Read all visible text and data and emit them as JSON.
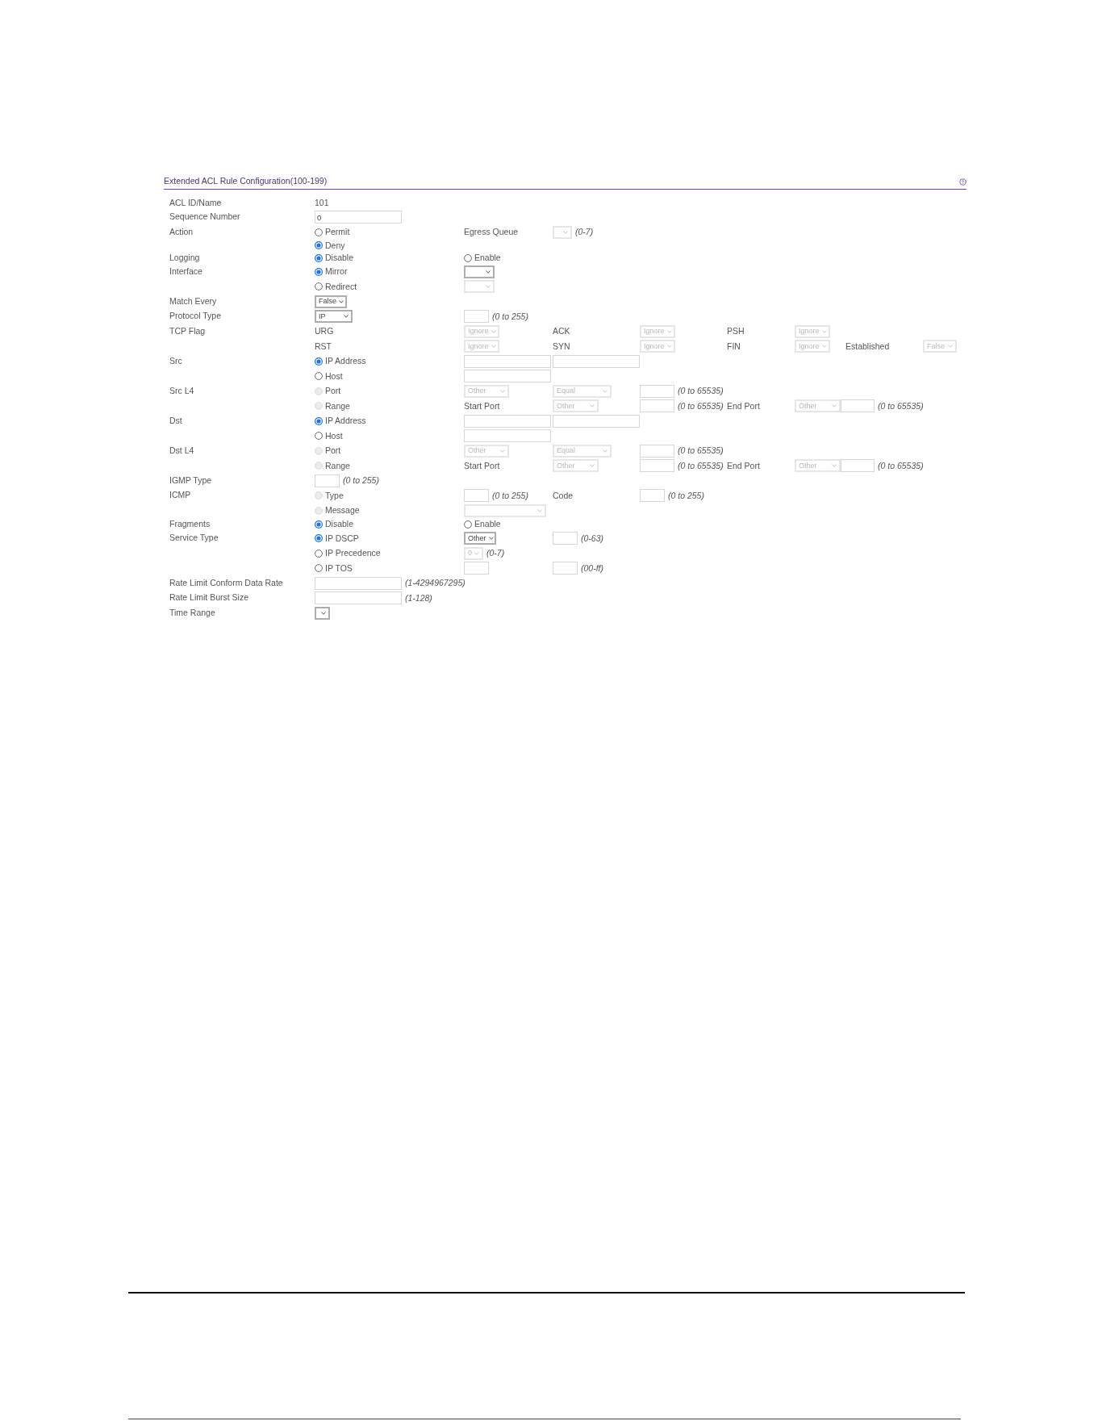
{
  "panel": {
    "title": "Extended ACL Rule Configuration(100-199)"
  },
  "lines": [
    {
      "label": "ACL ID/Name",
      "cells": [
        [
          {
            "kind": "value",
            "text": "101"
          }
        ]
      ]
    },
    {
      "label": "Sequence Number",
      "cells": [
        [
          {
            "kind": "input",
            "value": "0"
          }
        ]
      ]
    },
    {
      "label": "Action",
      "cells": [
        [
          {
            "kind": "radio",
            "label": "Permit",
            "checked": false,
            "disabled": false
          }
        ],
        [
          {
            "kind": "text",
            "text": "Egress Queue"
          }
        ],
        [
          {
            "kind": "select",
            "disabled": true
          },
          {
            "kind": "hint",
            "text": "(0-7)"
          }
        ]
      ]
    },
    {
      "cells": [
        [
          {
            "kind": "radio",
            "label": "Deny",
            "checked": true,
            "disabled": false
          }
        ]
      ]
    },
    {
      "label": "Logging",
      "cells": [
        [
          {
            "kind": "radio",
            "label": "Disable",
            "checked": true,
            "disabled": false
          }
        ],
        [
          {
            "kind": "radio",
            "label": "Enable",
            "checked": false,
            "disabled": false
          }
        ]
      ]
    },
    {
      "label": "Interface",
      "cells": [
        [
          {
            "kind": "radio",
            "label": "Mirror",
            "checked": true,
            "disabled": false
          }
        ],
        [
          {
            "kind": "select",
            "disabled": false
          }
        ]
      ]
    },
    {
      "cells": [
        [
          {
            "kind": "radio",
            "label": "Redirect",
            "checked": false,
            "disabled": false
          }
        ],
        [
          {
            "kind": "select",
            "disabled": true
          }
        ]
      ]
    },
    {
      "label": "Match Every",
      "cells": [
        [
          {
            "kind": "select",
            "value": "False",
            "disabled": false
          }
        ]
      ]
    },
    {
      "label": "Protocol Type",
      "cells": [
        [
          {
            "kind": "select",
            "value": "IP",
            "disabled": false
          }
        ],
        [
          {
            "kind": "input"
          },
          {
            "kind": "hint",
            "text": "(0 to 255)"
          }
        ]
      ]
    },
    {
      "label": "TCP Flag",
      "cells": [
        [
          {
            "kind": "text",
            "text": "URG"
          }
        ],
        [
          {
            "kind": "select",
            "value": "Ignore",
            "disabled": true
          }
        ],
        [
          {
            "kind": "text",
            "text": "ACK"
          }
        ],
        [
          {
            "kind": "select",
            "value": "Ignore",
            "disabled": true
          }
        ],
        [
          {
            "kind": "text",
            "text": "PSH"
          }
        ],
        [
          {
            "kind": "select",
            "value": "Ignore",
            "disabled": true
          }
        ]
      ]
    },
    {
      "cells": [
        [
          {
            "kind": "text",
            "text": "RST"
          }
        ],
        [
          {
            "kind": "select",
            "value": "Ignore",
            "disabled": true
          }
        ],
        [
          {
            "kind": "text",
            "text": "SYN"
          }
        ],
        [
          {
            "kind": "select",
            "value": "Ignore",
            "disabled": true
          }
        ],
        [
          {
            "kind": "text",
            "text": "FIN"
          }
        ],
        [
          {
            "kind": "select",
            "value": "Ignore",
            "disabled": true
          }
        ],
        [
          {
            "kind": "text",
            "text": "Established"
          }
        ],
        [
          {
            "kind": "select",
            "value": "False",
            "disabled": true
          }
        ]
      ]
    },
    {
      "label": "Src",
      "cells": [
        [
          {
            "kind": "radio",
            "label": "IP Address",
            "checked": true,
            "disabled": false
          }
        ],
        [
          {
            "kind": "input"
          }
        ],
        [
          {
            "kind": "input"
          }
        ]
      ]
    },
    {
      "cells": [
        [
          {
            "kind": "radio",
            "label": "Host",
            "checked": false,
            "disabled": false
          }
        ],
        [
          {
            "kind": "input"
          }
        ]
      ]
    },
    {
      "label": "Src L4",
      "cells": [
        [
          {
            "kind": "radio",
            "label": "Port",
            "checked": false,
            "disabled": true
          }
        ],
        [
          {
            "kind": "select",
            "value": "Other",
            "disabled": true
          }
        ],
        [
          {
            "kind": "select",
            "value": "Equal",
            "disabled": true
          }
        ],
        [
          {
            "kind": "input"
          },
          {
            "kind": "hint",
            "text": "(0 to 65535)"
          }
        ]
      ]
    },
    {
      "cells": [
        [
          {
            "kind": "radio",
            "label": "Range",
            "checked": false,
            "disabled": true
          }
        ],
        [
          {
            "kind": "text",
            "text": "Start Port"
          }
        ],
        [
          {
            "kind": "select",
            "value": "Other",
            "disabled": true
          }
        ],
        [
          {
            "kind": "input"
          },
          {
            "kind": "hint",
            "text": "(0 to 65535)"
          }
        ],
        [
          {
            "kind": "text",
            "text": "End Port"
          }
        ],
        [
          {
            "kind": "select",
            "value": "Other",
            "disabled": true
          },
          {
            "kind": "input"
          },
          {
            "kind": "hint",
            "text": "(0 to 65535)"
          }
        ]
      ]
    },
    {
      "label": "Dst",
      "cells": [
        [
          {
            "kind": "radio",
            "label": "IP Address",
            "checked": true,
            "disabled": false
          }
        ],
        [
          {
            "kind": "input"
          }
        ],
        [
          {
            "kind": "input"
          }
        ]
      ]
    },
    {
      "cells": [
        [
          {
            "kind": "radio",
            "label": "Host",
            "checked": false,
            "disabled": false
          }
        ],
        [
          {
            "kind": "input"
          }
        ]
      ]
    },
    {
      "label": "Dst L4",
      "cells": [
        [
          {
            "kind": "radio",
            "label": "Port",
            "checked": false,
            "disabled": true
          }
        ],
        [
          {
            "kind": "select",
            "value": "Other",
            "disabled": true
          }
        ],
        [
          {
            "kind": "select",
            "value": "Equal",
            "disabled": true
          }
        ],
        [
          {
            "kind": "input"
          },
          {
            "kind": "hint",
            "text": "(0 to 65535)"
          }
        ]
      ]
    },
    {
      "cells": [
        [
          {
            "kind": "radio",
            "label": "Range",
            "checked": false,
            "disabled": true
          }
        ],
        [
          {
            "kind": "text",
            "text": "Start Port"
          }
        ],
        [
          {
            "kind": "select",
            "value": "Other",
            "disabled": true
          }
        ],
        [
          {
            "kind": "input"
          },
          {
            "kind": "hint",
            "text": "(0 to 65535)"
          }
        ],
        [
          {
            "kind": "text",
            "text": "End Port"
          }
        ],
        [
          {
            "kind": "select",
            "value": "Other",
            "disabled": true
          },
          {
            "kind": "input"
          },
          {
            "kind": "hint",
            "text": "(0 to 65535)"
          }
        ]
      ]
    },
    {
      "label": "IGMP Type",
      "cells": [
        [
          {
            "kind": "input"
          },
          {
            "kind": "hint",
            "text": "(0 to 255)"
          }
        ]
      ]
    },
    {
      "label": "ICMP",
      "cells": [
        [
          {
            "kind": "radio",
            "label": "Type",
            "checked": false,
            "disabled": true
          }
        ],
        [
          {
            "kind": "input"
          },
          {
            "kind": "hint",
            "text": "(0 to 255)"
          }
        ],
        [
          {
            "kind": "text",
            "text": "Code"
          }
        ],
        [
          {
            "kind": "input"
          },
          {
            "kind": "hint",
            "text": "(0 to 255)"
          }
        ]
      ]
    },
    {
      "cells": [
        [
          {
            "kind": "radio",
            "label": "Message",
            "checked": false,
            "disabled": true
          }
        ],
        [
          {
            "kind": "select",
            "disabled": true
          }
        ]
      ]
    },
    {
      "label": "Fragments",
      "cells": [
        [
          {
            "kind": "radio",
            "label": "Disable",
            "checked": true,
            "disabled": false
          }
        ],
        [
          {
            "kind": "radio",
            "label": "Enable",
            "checked": false,
            "disabled": false
          }
        ]
      ]
    },
    {
      "label": "Service Type",
      "cells": [
        [
          {
            "kind": "radio",
            "label": "IP DSCP",
            "checked": true,
            "disabled": false
          }
        ],
        [
          {
            "kind": "select",
            "value": "Other",
            "disabled": false
          }
        ],
        [
          {
            "kind": "input"
          },
          {
            "kind": "hint",
            "text": "(0-63)"
          }
        ]
      ]
    },
    {
      "cells": [
        [
          {
            "kind": "radio",
            "label": "IP Precedence",
            "checked": false,
            "disabled": false
          }
        ],
        [
          {
            "kind": "select",
            "value": "0",
            "disabled": true
          },
          {
            "kind": "hint",
            "text": "(0-7)"
          }
        ]
      ]
    },
    {
      "cells": [
        [
          {
            "kind": "radio",
            "label": "IP TOS",
            "checked": false,
            "disabled": false
          }
        ],
        [
          {
            "kind": "input"
          }
        ],
        [
          {
            "kind": "input"
          },
          {
            "kind": "hint",
            "text": "(00-ff)"
          }
        ]
      ]
    },
    {
      "label": "Rate Limit Conform Data Rate",
      "cells": [
        [
          {
            "kind": "input"
          },
          {
            "kind": "hint",
            "text": "(1-4294967295)"
          }
        ]
      ]
    },
    {
      "label": "Rate Limit Burst Size",
      "cells": [
        [
          {
            "kind": "input"
          },
          {
            "kind": "hint",
            "text": "(1-128)"
          }
        ]
      ]
    },
    {
      "label": "Time Range",
      "cells": [
        [
          {
            "kind": "select",
            "disabled": false
          }
        ]
      ]
    }
  ]
}
